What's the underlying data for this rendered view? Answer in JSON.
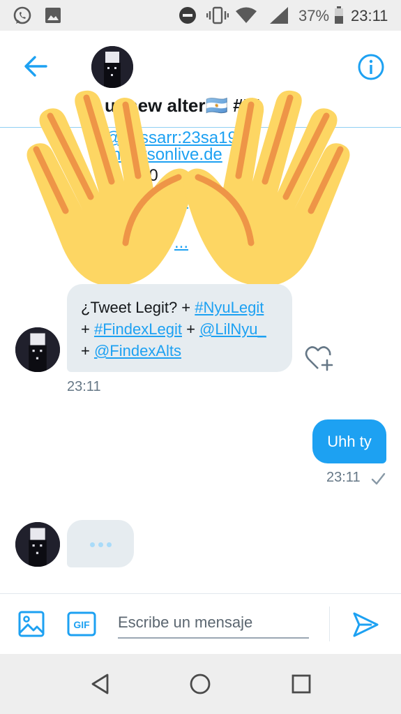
{
  "status_bar": {
    "battery": "37%",
    "time": "23:11",
    "icons": [
      "whatsapp-icon",
      "image-icon",
      "do-not-disturb-icon",
      "vibrate-icon",
      "wifi-icon",
      "signal-icon",
      "battery-icon"
    ]
  },
  "header": {
    "title": "u; new alter🇦🇷 #IT",
    "back_icon": "arrow-left-icon",
    "info_icon": "info-icon"
  },
  "faded": {
    "line1": "@nessarr:23sa198",
    "line2": "hichtsonlive.de",
    "line3": "70",
    "line4": "...",
    "line5": "..."
  },
  "overlay": {
    "emoji": "raised-hands"
  },
  "messages": {
    "received": {
      "prefix": "¿Tweet Legit? + ",
      "tag1": "#NyuLegit",
      "plus1": "+ ",
      "tag2": "#FindexLegit",
      "plus2": " + ",
      "mention1": "@LilNyu_",
      "plus3": "+ ",
      "mention2": "@FindexAlts",
      "time": "23:11"
    },
    "sent": {
      "text": "Uhh ty",
      "time": "23:11"
    }
  },
  "compose": {
    "placeholder": "Escribe un mensaje",
    "gif_label": "GIF"
  },
  "colors": {
    "accent": "#1da1f2",
    "bubble_received": "#e6ecf0",
    "emoji_yellow": "#fdd663",
    "emoji_orange": "#ee9547"
  }
}
